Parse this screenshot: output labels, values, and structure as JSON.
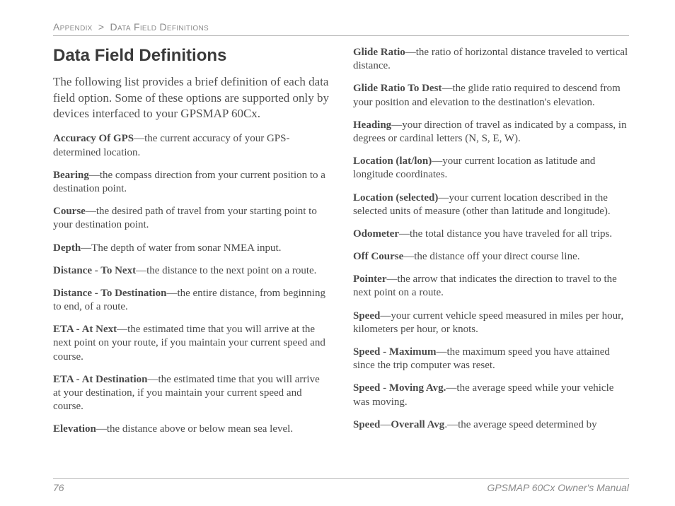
{
  "breadcrumb": {
    "section": "Appendix",
    "sep": ">",
    "sub": "Data Field Definitions"
  },
  "title": "Data Field Definitions",
  "intro": "The following list provides a brief definition of each data field option. Some of these options are supported only by devices interfaced to your GPSMAP 60Cx.",
  "defs": [
    {
      "term": "Accuracy Of GPS",
      "sep": "—",
      "desc": "the current accuracy of your GPS-determined location."
    },
    {
      "term": "Bearing",
      "sep": "—",
      "desc": "the compass direction from your current position to a destination point."
    },
    {
      "term": "Course",
      "sep": "—",
      "desc": "the desired path of travel from your starting point to your destination point."
    },
    {
      "term": "Depth",
      "sep": "—",
      "desc": "The depth of water from sonar NMEA input."
    },
    {
      "term": "Distance  - To Next",
      "sep": "—",
      "desc": "the distance to the next point on a route."
    },
    {
      "term": "Distance -  To Destination",
      "sep": "—",
      "desc": "the entire distance, from beginning to end, of a route."
    },
    {
      "term": "ETA -  At Next",
      "sep": "—",
      "desc": "the estimated time that you will arrive at the next point on your route, if you maintain your current speed and course."
    },
    {
      "term": "ETA -  At Destination",
      "sep": "—",
      "desc": "the estimated time that you will arrive at your destination, if you maintain your current speed and course."
    },
    {
      "term": "Elevation",
      "sep": "—",
      "desc": "the distance above or below mean sea level."
    },
    {
      "term": "Glide Ratio",
      "sep": "—",
      "desc": "the ratio of horizontal distance traveled to vertical distance."
    },
    {
      "term": "Glide Ratio To Dest",
      "sep": "—",
      "desc": "the glide ratio required to descend from your position and elevation to the destination's elevation."
    },
    {
      "term": "Heading",
      "sep": "—",
      "desc": "your direction of travel as indicated by a compass, in degrees or cardinal letters (N, S, E, W)."
    },
    {
      "term": "Location (lat/lon)",
      "sep": "—",
      "desc": "your current location as latitude and longitude coordinates."
    },
    {
      "term": "Location (selected)",
      "sep": "—",
      "desc": "your current location described in the selected units of measure (other than latitude and longitude)."
    },
    {
      "term": "Odometer",
      "sep": "—",
      "desc": "the total distance you have traveled for all trips."
    },
    {
      "term": "Off Course",
      "sep": "—",
      "desc": "the distance off your direct course line."
    },
    {
      "term": "Pointer",
      "sep": "—",
      "desc": "the arrow that indicates the direction to travel to the next point on a route."
    },
    {
      "term": "Speed",
      "sep": "—",
      "desc": "your current vehicle speed measured in miles per hour, kilometers per hour, or knots."
    },
    {
      "term": "Speed",
      "sep": " - ",
      "term2": "Maximum",
      "sep2": "—",
      "desc": "the maximum speed you have attained since the trip computer was reset."
    },
    {
      "term": "Speed",
      "sep": " - ",
      "term2": "Moving Avg.",
      "sep2": "—",
      "desc": "the average speed while your vehicle was moving."
    },
    {
      "term": "Speed",
      "sep": "—",
      "term2": "Overall Avg",
      "sep2": ".—",
      "desc": "the average speed determined by"
    }
  ],
  "footer": {
    "page": "76",
    "manual": "GPSMAP 60Cx Owner's Manual"
  }
}
